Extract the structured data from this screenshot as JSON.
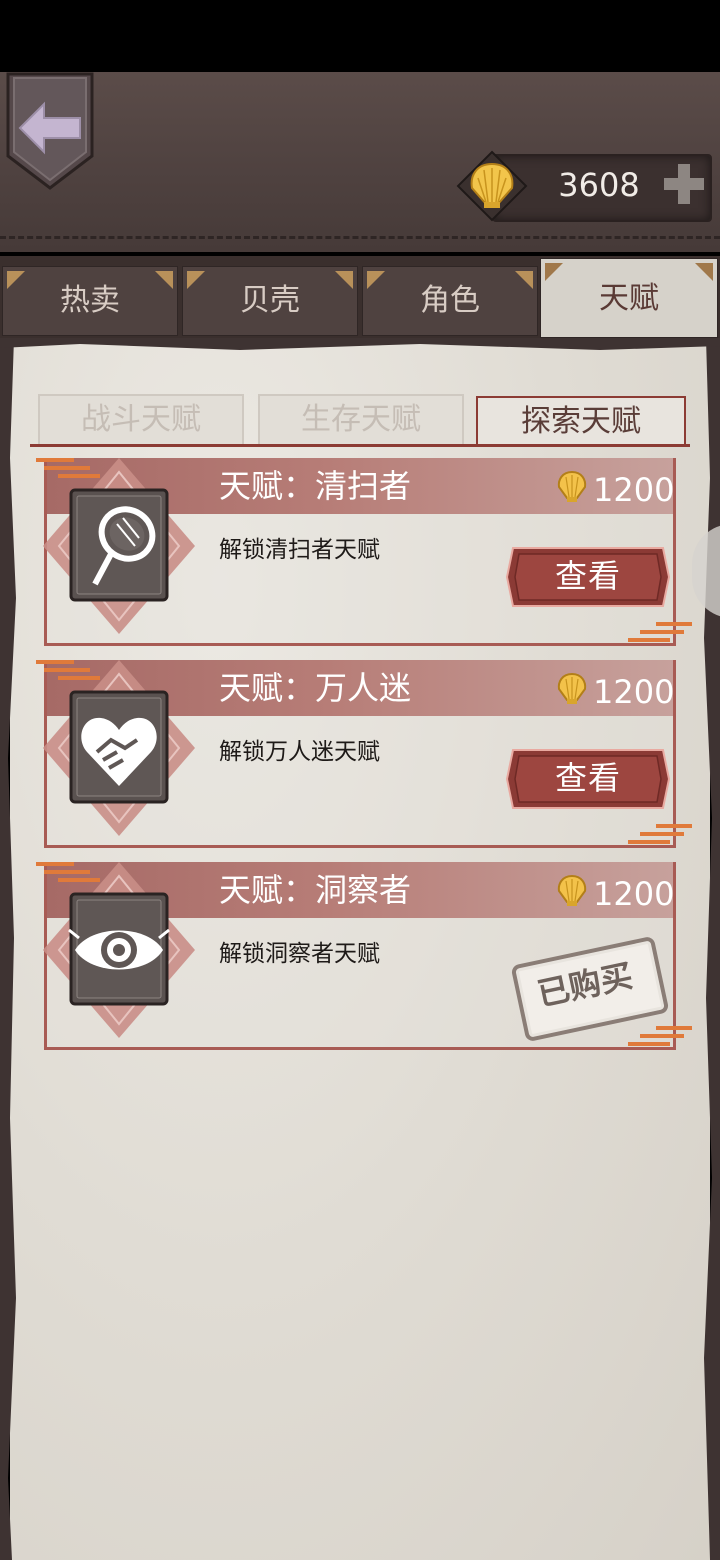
{
  "currency": {
    "amount": "3608",
    "icon": "shell-coin-icon",
    "add_icon": "plus-icon"
  },
  "nav": {
    "back_icon": "back-arrow-icon"
  },
  "tabs": [
    {
      "label": "热卖",
      "active": false
    },
    {
      "label": "贝壳",
      "active": false
    },
    {
      "label": "角色",
      "active": false
    },
    {
      "label": "天赋",
      "active": true
    }
  ],
  "subtabs": [
    {
      "label": "战斗天赋",
      "active": false
    },
    {
      "label": "生存天赋",
      "active": false
    },
    {
      "label": "探索天赋",
      "active": true
    }
  ],
  "talents": [
    {
      "title": "天赋：清扫者",
      "price": "1200",
      "desc": "解锁清扫者天赋",
      "icon": "magnifying-glass-icon",
      "action": "查看",
      "purchased": false
    },
    {
      "title": "天赋：万人迷",
      "price": "1200",
      "desc": "解锁万人迷天赋",
      "icon": "heart-handshake-icon",
      "action": "查看",
      "purchased": false
    },
    {
      "title": "天赋：洞察者",
      "price": "1200",
      "desc": "解锁洞察者天赋",
      "icon": "eye-icon",
      "action": "已购买",
      "purchased": true
    }
  ],
  "colors": {
    "accent": "#a85b54",
    "button": "#8b3a35",
    "paper": "#e3dfd8",
    "header": "#4e413f",
    "gold": "#f3c24a"
  }
}
